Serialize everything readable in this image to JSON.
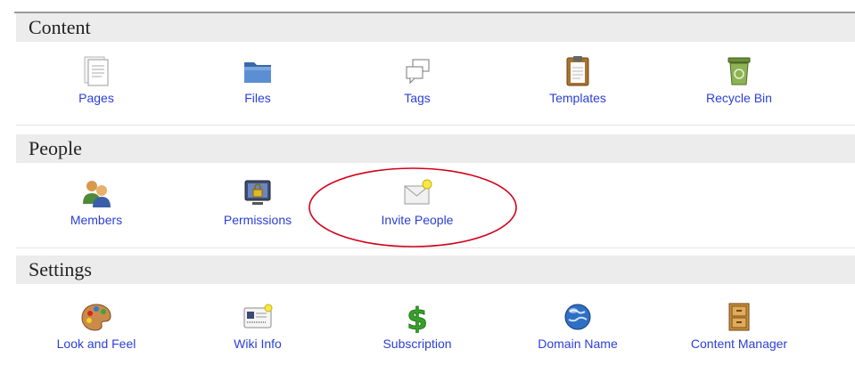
{
  "sections": [
    {
      "title": "Content",
      "items": [
        {
          "label": "Pages",
          "icon": "pages-icon"
        },
        {
          "label": "Files",
          "icon": "folder-icon"
        },
        {
          "label": "Tags",
          "icon": "tags-icon"
        },
        {
          "label": "Templates",
          "icon": "clipboard-icon"
        },
        {
          "label": "Recycle Bin",
          "icon": "recycle-bin-icon"
        }
      ]
    },
    {
      "title": "People",
      "items": [
        {
          "label": "Members",
          "icon": "members-icon"
        },
        {
          "label": "Permissions",
          "icon": "lock-monitor-icon"
        },
        {
          "label": "Invite People",
          "icon": "envelope-icon"
        }
      ]
    },
    {
      "title": "Settings",
      "items": [
        {
          "label": "Look and Feel",
          "icon": "palette-icon"
        },
        {
          "label": "Wiki Info",
          "icon": "id-card-icon"
        },
        {
          "label": "Subscription",
          "icon": "dollar-icon"
        },
        {
          "label": "Domain Name",
          "icon": "globe-icon"
        },
        {
          "label": "Content Manager",
          "icon": "cabinet-icon"
        }
      ]
    }
  ],
  "colors": {
    "link": "#2a3fd6",
    "header_bg": "#ececec",
    "highlight_ring": "#d0021b"
  }
}
